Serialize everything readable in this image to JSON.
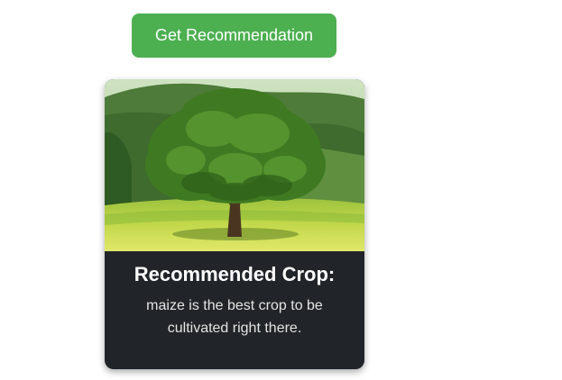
{
  "action": {
    "button_label": "Get Recommendation"
  },
  "result": {
    "image_icon": "tree-landscape-image",
    "title": "Recommended Crop:",
    "message": "maize is the best crop to be cultivated right there."
  },
  "colors": {
    "button_bg": "#4caf50",
    "card_bg": "#212529",
    "text": "#ffffff"
  }
}
